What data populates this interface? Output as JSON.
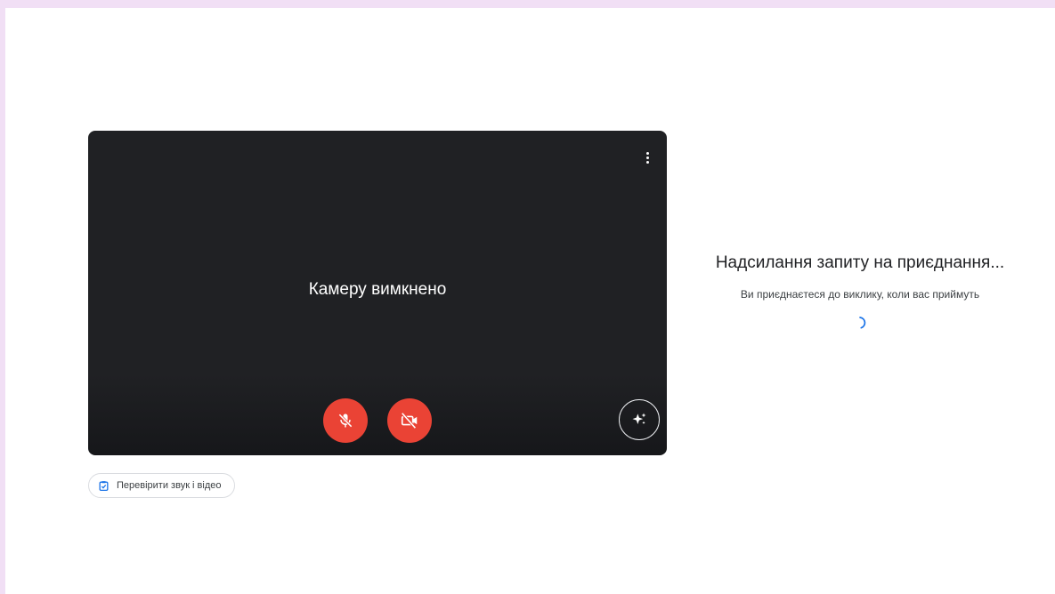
{
  "preview": {
    "camera_off_text": "Камеру вимкнено"
  },
  "check_button": {
    "label": "Перевірити звук і відео"
  },
  "join_status": {
    "title": "Надсилання запиту на приєднання...",
    "subtitle": "Ви приєднаєтеся до виклику, коли вас приймуть"
  },
  "icons": {
    "more": "more-vert-icon",
    "mic": "mic-off-icon",
    "camera": "videocam-off-icon",
    "effects": "sparkle-effects-icon",
    "check": "check-av-icon",
    "spinner": "loading-spinner-icon"
  },
  "colors": {
    "preview_bg": "#202124",
    "control_off": "#ea4335",
    "accent": "#1a73e8"
  }
}
